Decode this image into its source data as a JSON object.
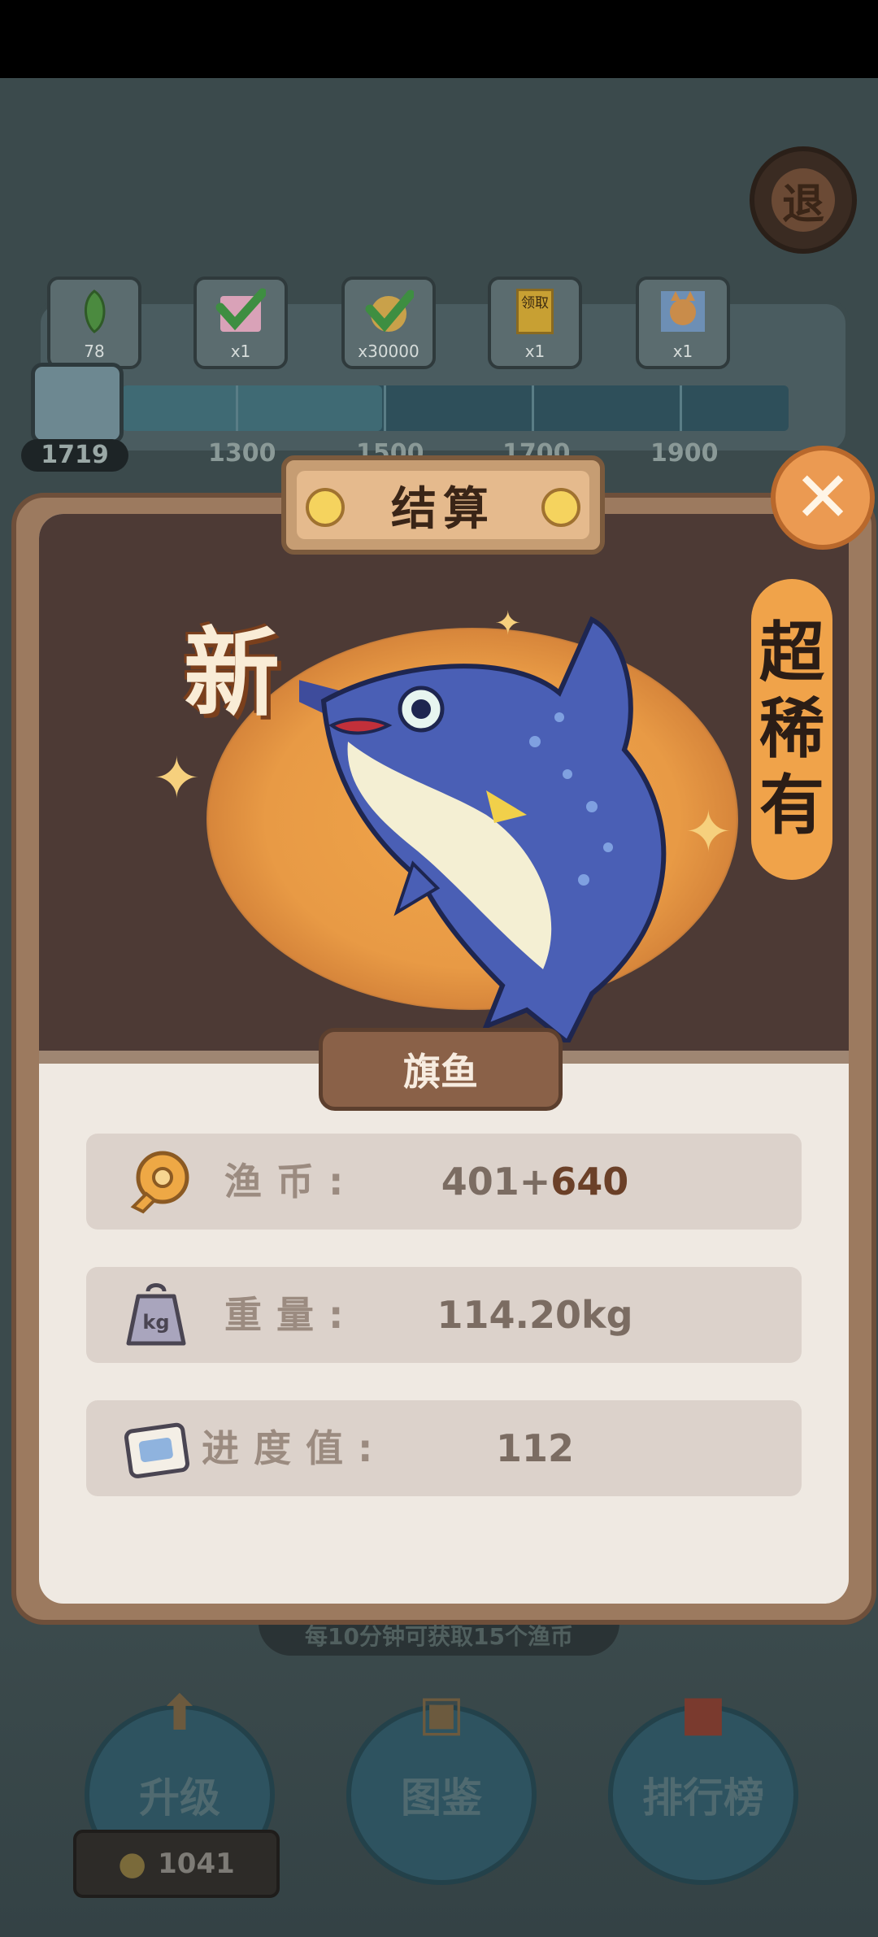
{
  "exit": {
    "label": "退"
  },
  "rewards": {
    "items": [
      {
        "qty": "78",
        "icon": "leaf-icon"
      },
      {
        "qty": "x1",
        "icon": "checkmark-card-icon"
      },
      {
        "qty": "x30000",
        "icon": "checkmark-coin-icon"
      },
      {
        "qty": "x1",
        "icon": "claim-card-icon",
        "icon_text": "领取"
      },
      {
        "qty": "x1",
        "icon": "character-card-icon"
      }
    ],
    "current": "1719",
    "milestones": [
      "1300",
      "1500",
      "1700",
      "1900"
    ],
    "progress_fraction": 0.39
  },
  "dialog": {
    "title": "结算",
    "new_badge": "新",
    "rarity": [
      "超",
      "稀",
      "有"
    ],
    "fish_name": "旗鱼",
    "stats": [
      {
        "label": "渔币:",
        "value": "401+",
        "bonus": "640",
        "icon": "coin-icon"
      },
      {
        "label": "重量:",
        "value": "114.20kg",
        "icon": "weight-icon"
      },
      {
        "label": "进度值:",
        "value": "112",
        "icon": "progress-ticket-icon"
      }
    ]
  },
  "hint": "每10分钟可获取15个渔币",
  "bottom_nav": {
    "upgrade": "升级",
    "album": "图鉴",
    "ranking": "排行榜",
    "coins": "1041"
  },
  "colors": {
    "accent_orange": "#eb9a52",
    "panel_brown": "#4d3a35",
    "card_bg": "#efe9e2"
  }
}
